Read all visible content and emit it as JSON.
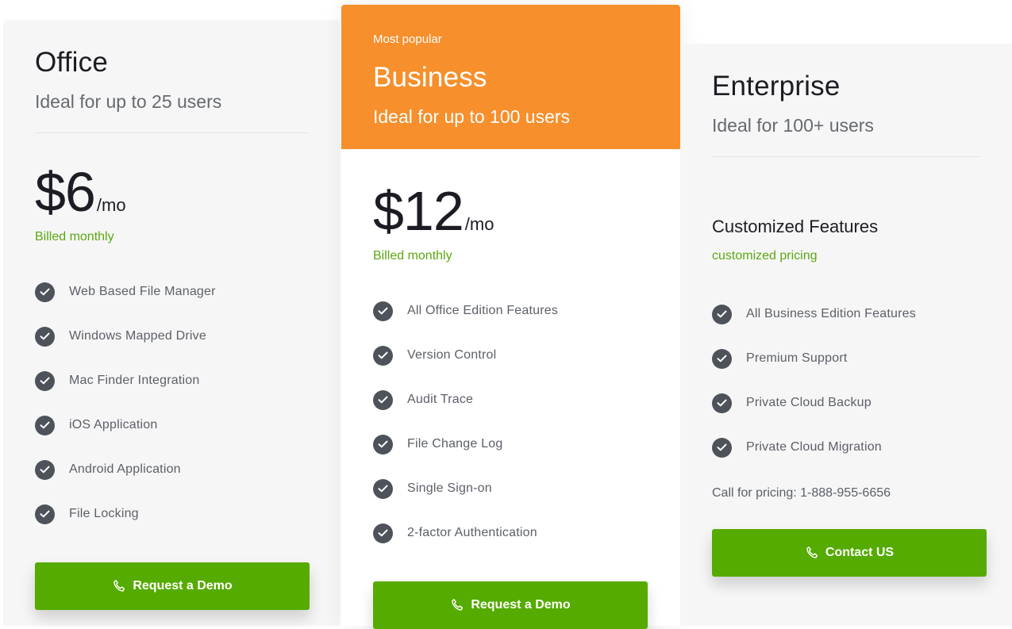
{
  "plans": [
    {
      "name": "Office",
      "subtitle": "Ideal for up to 25 users",
      "price": "$6",
      "period": "/mo",
      "billing": "Billed monthly",
      "features": [
        "Web Based File Manager",
        "Windows Mapped Drive",
        "Mac Finder Integration",
        "iOS Application",
        "Android Application",
        "File Locking"
      ],
      "cta": "Request a Demo"
    },
    {
      "badge": "Most popular",
      "name": "Business",
      "subtitle": "Ideal for up to 100 users",
      "price": "$12",
      "period": "/mo",
      "billing": "Billed monthly",
      "features": [
        "All Office Edition Features",
        "Version Control",
        "Audit Trace",
        "File Change Log",
        "Single Sign-on",
        "2-factor Authentication"
      ],
      "cta": "Request a Demo"
    },
    {
      "name": "Enterprise",
      "subtitle": "Ideal for 100+ users",
      "custom_title": "Customized Features",
      "billing": "customized pricing",
      "features": [
        "All Business Edition Features",
        "Premium Support",
        "Private Cloud Backup",
        "Private Cloud Migration"
      ],
      "call_text": "Call for pricing: 1-888-955-6656",
      "cta": "Contact US"
    }
  ],
  "icons": {
    "check": "check-circle-icon",
    "cta": "phone-icon"
  },
  "colors": {
    "accent_orange": "#f68f2c",
    "button_green": "#55ab00",
    "billing_green": "#5aa812",
    "check_gray": "#4e525a"
  }
}
